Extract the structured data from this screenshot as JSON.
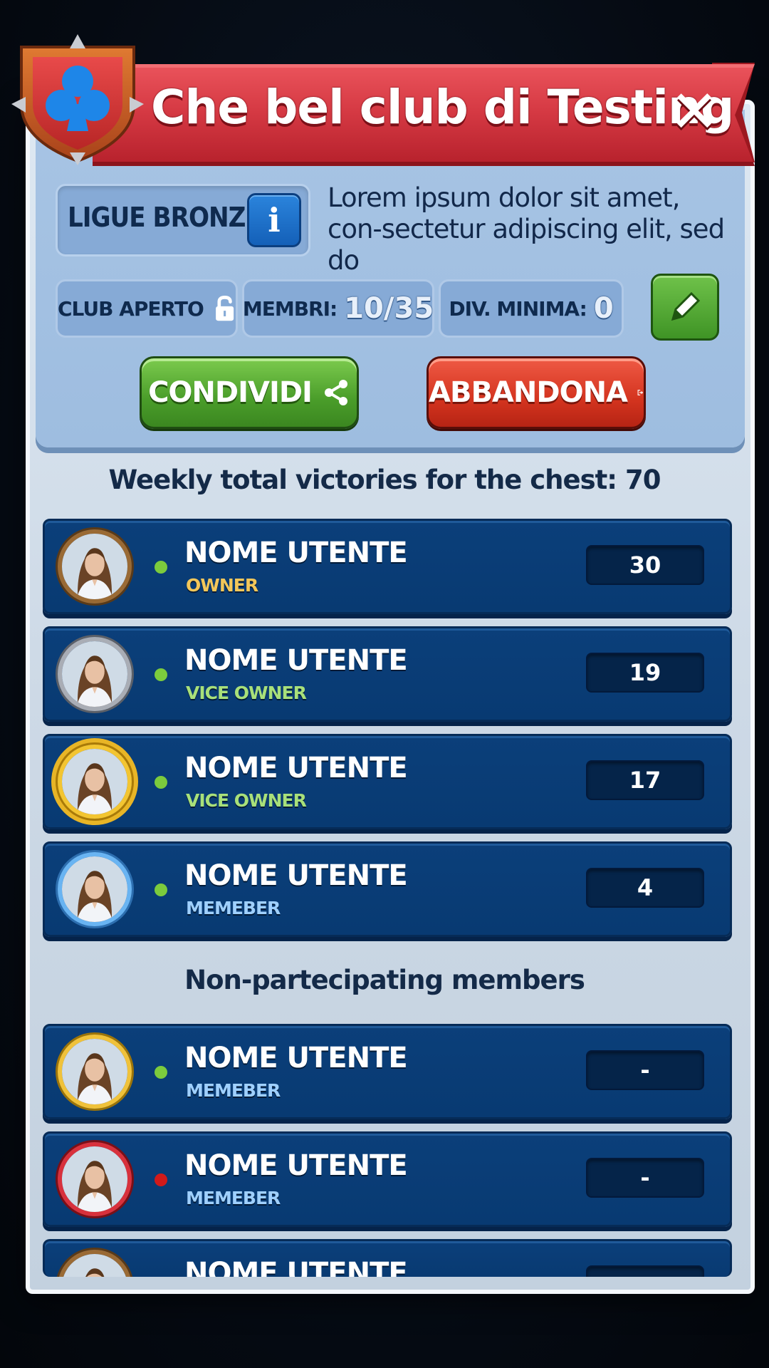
{
  "header": {
    "title": "Che bel club di Testing",
    "close_icon": "close-icon",
    "club_icon": "club-suit-shield-icon"
  },
  "league": {
    "label": "LIGUE BRONZE",
    "info_symbol": "i"
  },
  "description": "Lorem ipsum dolor sit amet, con-sectetur adipiscing elit, sed do",
  "stats": {
    "open_label": "CLUB APERTO",
    "members_label": "MEMBRI:",
    "members_value": "10/35",
    "min_div_label": "DIV. MINIMA:",
    "min_div_value": "0"
  },
  "actions": {
    "share_label": "CONDIVIDI",
    "leave_label": "ABBANDONA"
  },
  "weekly_title": "Weekly total victories for the chest: 70",
  "non_participating_title": "Non-partecipating members",
  "participating_members": [
    {
      "name": "NOME UTENTE",
      "role": "OWNER",
      "score": "30",
      "status": "online",
      "frame": "bronze"
    },
    {
      "name": "NOME UTENTE",
      "role": "VICE OWNER",
      "score": "19",
      "status": "online",
      "frame": "silver"
    },
    {
      "name": "NOME UTENTE",
      "role": "VICE OWNER",
      "score": "17",
      "status": "online",
      "frame": "gold-laurel"
    },
    {
      "name": "NOME UTENTE",
      "role": "MEMEBER",
      "score": "4",
      "status": "online",
      "frame": "blue"
    }
  ],
  "non_participating_members": [
    {
      "name": "NOME UTENTE",
      "role": "MEMEBER",
      "score": "-",
      "status": "online",
      "frame": "gold"
    },
    {
      "name": "NOME UTENTE",
      "role": "MEMEBER",
      "score": "-",
      "status": "offline",
      "frame": "red"
    },
    {
      "name": "NOME UTENTE",
      "role": "",
      "score": "",
      "status": "",
      "frame": "bronze"
    }
  ],
  "colors": {
    "owner_role": "#f3c75a",
    "vice_owner_role": "#a8e07a",
    "member_role": "#9fd0ff",
    "online": "#7ccb3d",
    "offline": "#d11a1a"
  }
}
